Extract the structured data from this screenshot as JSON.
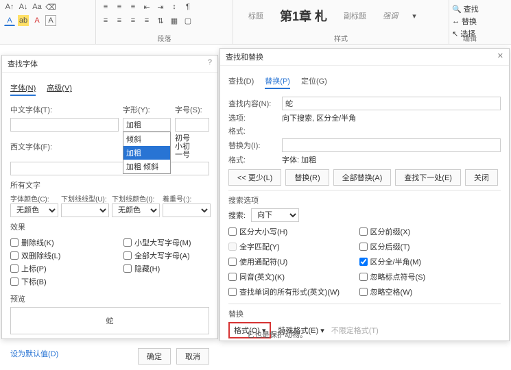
{
  "ribbon": {
    "groups": {
      "para": "段落",
      "styles": "样式",
      "edit": "编辑"
    },
    "style_items": [
      "标题",
      "第1章 札",
      "副标题",
      "强调"
    ],
    "edit": {
      "find": "查找",
      "replace": "替换",
      "select": "选择"
    }
  },
  "font_dialog": {
    "title": "查找字体",
    "tabs": {
      "font": "字体(N)",
      "advanced": "高级(V)"
    },
    "labels": {
      "cn_font": "中文字体(T):",
      "style": "字形(Y):",
      "size": "字号(S):",
      "west_font": "西文字体(F):",
      "all_text": "所有文字",
      "font_color": "字体颜色(C):",
      "underline_style": "下划线线型(U):",
      "underline_color": "下划线颜色(I):",
      "emphasis": "着重号(:):",
      "no_color": "无颜色",
      "effects": "效果",
      "preview": "预览"
    },
    "style_value": "加粗",
    "style_options": [
      "倾斜",
      "加粗",
      "加粗 倾斜"
    ],
    "size_options": [
      "初号",
      "小初",
      "一号"
    ],
    "checks": {
      "strike": "删除线(K)",
      "dstrike": "双删除线(L)",
      "superscript": "上标(P)",
      "subscript": "下标(B)",
      "smallcaps": "小型大写字母(M)",
      "allcaps": "全部大写字母(A)",
      "hidden": "隐藏(H)"
    },
    "preview_text": "蛇",
    "buttons": {
      "default": "设为默认值(D)",
      "ok": "确定",
      "cancel": "取消"
    }
  },
  "fr_dialog": {
    "title": "查找和替换",
    "tabs": {
      "find": "查找(D)",
      "replace": "替换(P)",
      "goto": "定位(G)"
    },
    "labels": {
      "find_what": "查找内容(N):",
      "options": "选项:",
      "format": "格式:",
      "replace_with": "替换为(I):",
      "format2": "格式:",
      "options_val": "向下搜索, 区分全/半角",
      "format_val": "字体: 加粗",
      "less": "<< 更少(L)",
      "replace": "替换(R)",
      "replace_all": "全部替换(A)",
      "find_next": "查找下一处(E)",
      "close": "关闭",
      "search_opts": "搜索选项",
      "search": "搜索:",
      "search_dir": "向下",
      "replace_section": "替换",
      "format_btn": "格式(O)",
      "special": "特殊格式(E)",
      "no_limit": "不限定格式(T)"
    },
    "find_value": "蛇",
    "checks": {
      "case": "区分大小写(H)",
      "whole": "全字匹配(Y)",
      "wildcard": "使用通配符(U)",
      "sounds": "同音(英文)(K)",
      "forms": "查找单词的所有形式(英文)(W)",
      "prefix": "区分前缀(X)",
      "suffix": "区分后缀(T)",
      "fullhalf": "区分全/半角(M)",
      "punct": "忽略标点符号(S)",
      "space": "忽略空格(W)"
    }
  },
  "footer": "它也是保护动物。"
}
